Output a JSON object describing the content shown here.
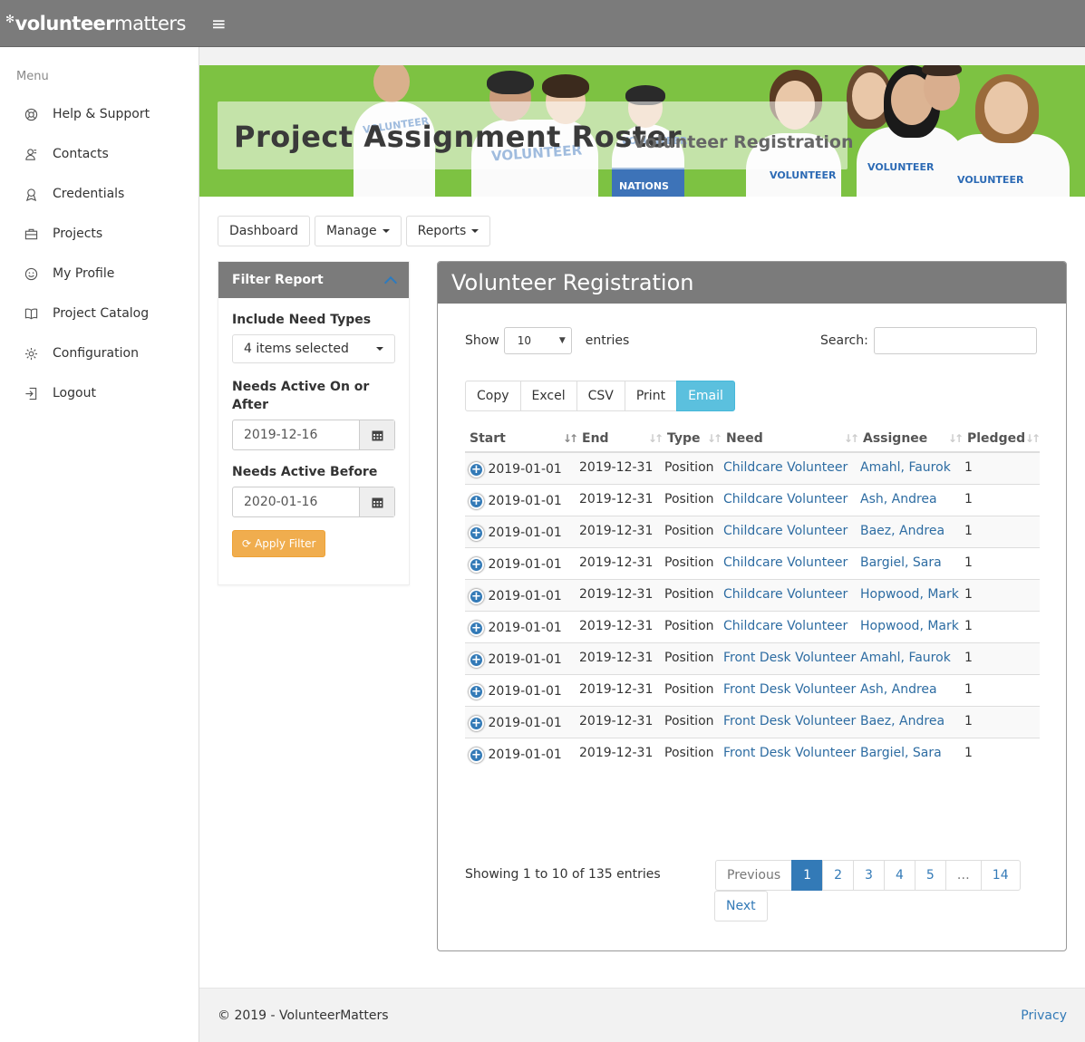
{
  "brand": {
    "bold": "volunteer",
    "light": "matters"
  },
  "sidebar": {
    "menu_label": "Menu",
    "items": [
      {
        "label": "Help & Support",
        "icon": "help-icon"
      },
      {
        "label": "Contacts",
        "icon": "contacts-icon"
      },
      {
        "label": "Credentials",
        "icon": "credentials-icon"
      },
      {
        "label": "Projects",
        "icon": "briefcase-icon"
      },
      {
        "label": "My Profile",
        "icon": "smile-icon"
      },
      {
        "label": "Project Catalog",
        "icon": "book-icon"
      },
      {
        "label": "Configuration",
        "icon": "gear-icon"
      },
      {
        "label": "Logout",
        "icon": "logout-icon"
      }
    ]
  },
  "banner": {
    "title": "Project Assignment Roster",
    "subtitle": "Volunteer Registration",
    "shirt_text": "VOLUNTEER",
    "box_text": "NATIONS"
  },
  "nav": {
    "dashboard": "Dashboard",
    "manage": "Manage",
    "reports": "Reports"
  },
  "filter": {
    "title": "Filter Report",
    "need_types_label": "Include Need Types",
    "need_types_value": "4 items selected",
    "active_on_label": "Needs Active On or After",
    "active_on_value": "2019-12-16",
    "active_before_label": "Needs Active Before",
    "active_before_value": "2020-01-16",
    "apply_label": "Apply Filter"
  },
  "report": {
    "title": "Volunteer Registration",
    "show_label": "Show",
    "entries_value": "10",
    "entries_label": "entries",
    "search_label": "Search:",
    "export": [
      "Copy",
      "Excel",
      "CSV",
      "Print",
      "Email"
    ],
    "columns": [
      "Start",
      "End",
      "Type",
      "Need",
      "Assignee",
      "Pledged"
    ],
    "rows": [
      {
        "start": "2019-01-01",
        "end": "2019-12-31",
        "type": "Position",
        "need": "Childcare Volunteer",
        "assignee": "Amahl, Faurok",
        "pledged": "1"
      },
      {
        "start": "2019-01-01",
        "end": "2019-12-31",
        "type": "Position",
        "need": "Childcare Volunteer",
        "assignee": "Ash, Andrea",
        "pledged": "1"
      },
      {
        "start": "2019-01-01",
        "end": "2019-12-31",
        "type": "Position",
        "need": "Childcare Volunteer",
        "assignee": "Baez, Andrea",
        "pledged": "1"
      },
      {
        "start": "2019-01-01",
        "end": "2019-12-31",
        "type": "Position",
        "need": "Childcare Volunteer",
        "assignee": "Bargiel, Sara",
        "pledged": "1"
      },
      {
        "start": "2019-01-01",
        "end": "2019-12-31",
        "type": "Position",
        "need": "Childcare Volunteer",
        "assignee": "Hopwood, Mark",
        "pledged": "1"
      },
      {
        "start": "2019-01-01",
        "end": "2019-12-31",
        "type": "Position",
        "need": "Childcare Volunteer",
        "assignee": "Hopwood, Mark",
        "pledged": "1"
      },
      {
        "start": "2019-01-01",
        "end": "2019-12-31",
        "type": "Position",
        "need": "Front Desk Volunteer",
        "assignee": "Amahl, Faurok",
        "pledged": "1"
      },
      {
        "start": "2019-01-01",
        "end": "2019-12-31",
        "type": "Position",
        "need": "Front Desk Volunteer",
        "assignee": "Ash, Andrea",
        "pledged": "1"
      },
      {
        "start": "2019-01-01",
        "end": "2019-12-31",
        "type": "Position",
        "need": "Front Desk Volunteer",
        "assignee": "Baez, Andrea",
        "pledged": "1"
      },
      {
        "start": "2019-01-01",
        "end": "2019-12-31",
        "type": "Position",
        "need": "Front Desk Volunteer",
        "assignee": "Bargiel, Sara",
        "pledged": "1"
      }
    ],
    "info": "Showing 1 to 10 of 135 entries",
    "pagination": {
      "previous": "Previous",
      "pages": [
        "1",
        "2",
        "3",
        "4",
        "5",
        "…",
        "14"
      ],
      "next": "Next",
      "active": "1"
    }
  },
  "footer": {
    "copyright": "© 2019 - VolunteerMatters",
    "privacy": "Privacy"
  },
  "colors": {
    "header": "#7b7b7b",
    "banner_green": "#7dc242",
    "accent_blue": "#337ab7",
    "email_button": "#5bc0de",
    "apply_button": "#f0ad4e"
  }
}
